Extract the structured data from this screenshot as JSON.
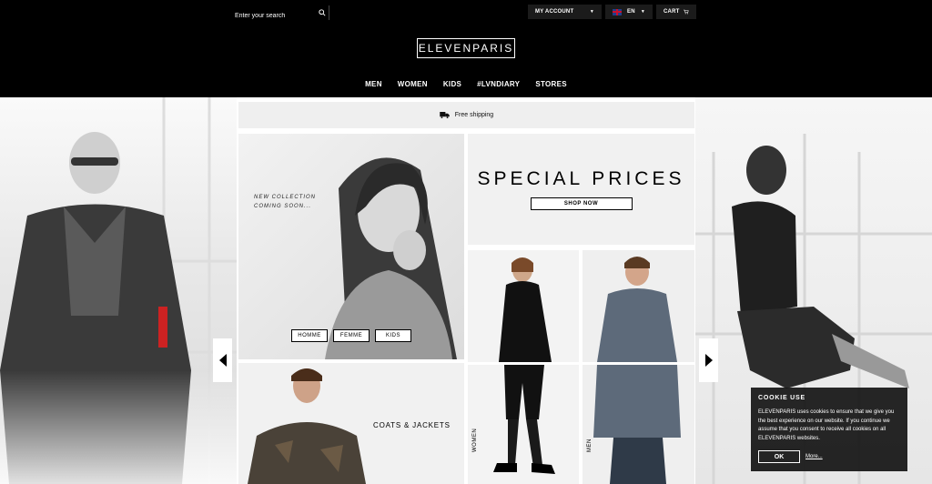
{
  "header": {
    "search_placeholder": "Enter your search",
    "account_label": "MY ACCOUNT",
    "language_label": "EN",
    "cart_label": "CART",
    "logo": "ELEVENPARIS"
  },
  "nav": {
    "items": [
      "MEN",
      "WOMEN",
      "KIDS",
      "#LVNDIARY",
      "STORES"
    ]
  },
  "shipping": {
    "text": "Free shipping"
  },
  "collection": {
    "line1": "NEW COLLECTION",
    "line2": "COMING SOON...",
    "buttons": [
      "HOMME",
      "FEMME",
      "KIDS"
    ]
  },
  "special": {
    "title": "SPECIAL PRICES",
    "button": "SHOP NOW"
  },
  "coats": {
    "label": "COATS & JACKETS"
  },
  "tiles": {
    "women_label": "WOMEN",
    "men_label": "MEN"
  },
  "cookie": {
    "title": "COOKIE USE",
    "text": "ELEVENPARIS uses cookies to ensure that we give you the best experience on our website. If you continue we assume that you consent to receive all cookies on all ELEVENPARIS websites.",
    "ok_label": "OK",
    "more_label": "More..."
  },
  "colors": {
    "header_bg": "#000000",
    "panel_bg": "#f1f1f1",
    "cookie_bg": "#141414"
  }
}
